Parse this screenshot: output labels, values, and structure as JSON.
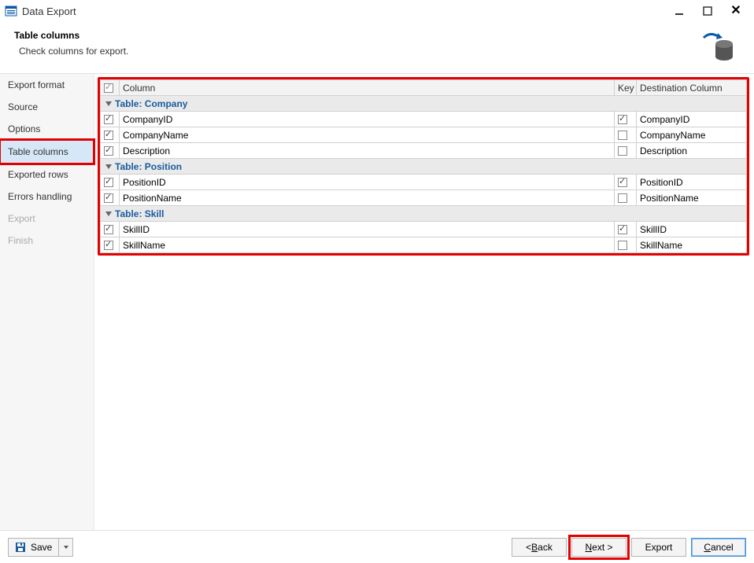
{
  "window": {
    "title": "Data Export"
  },
  "header": {
    "title": "Table columns",
    "subtitle": "Check columns for export."
  },
  "sidebar": {
    "items": [
      {
        "label": "Export format",
        "active": false,
        "disabled": false
      },
      {
        "label": "Source",
        "active": false,
        "disabled": false
      },
      {
        "label": "Options",
        "active": false,
        "disabled": false
      },
      {
        "label": "Table columns",
        "active": true,
        "disabled": false
      },
      {
        "label": "Exported rows",
        "active": false,
        "disabled": false
      },
      {
        "label": "Errors handling",
        "active": false,
        "disabled": false
      },
      {
        "label": "Export",
        "active": false,
        "disabled": true
      },
      {
        "label": "Finish",
        "active": false,
        "disabled": true
      }
    ]
  },
  "table": {
    "headers": {
      "chk_all": true,
      "column": "Column",
      "key": "Key",
      "dest": "Destination Column"
    },
    "groups": [
      {
        "title": "Table: Company",
        "rows": [
          {
            "checked": true,
            "name": "CompanyID",
            "key": true,
            "dest": "CompanyID"
          },
          {
            "checked": true,
            "name": "CompanyName",
            "key": false,
            "dest": "CompanyName"
          },
          {
            "checked": true,
            "name": "Description",
            "key": false,
            "dest": "Description"
          }
        ]
      },
      {
        "title": "Table: Position",
        "rows": [
          {
            "checked": true,
            "name": "PositionID",
            "key": true,
            "dest": "PositionID"
          },
          {
            "checked": true,
            "name": "PositionName",
            "key": false,
            "dest": "PositionName"
          }
        ]
      },
      {
        "title": "Table: Skill",
        "rows": [
          {
            "checked": true,
            "name": "SkillID",
            "key": true,
            "dest": "SkillID"
          },
          {
            "checked": true,
            "name": "SkillName",
            "key": false,
            "dest": "SkillName"
          }
        ]
      }
    ]
  },
  "footer": {
    "save": "Save",
    "back": "< Back",
    "next": "Next >",
    "export": "Export",
    "cancel": "Cancel",
    "back_hk": "B",
    "next_hk": "N",
    "cancel_hk": "C"
  }
}
